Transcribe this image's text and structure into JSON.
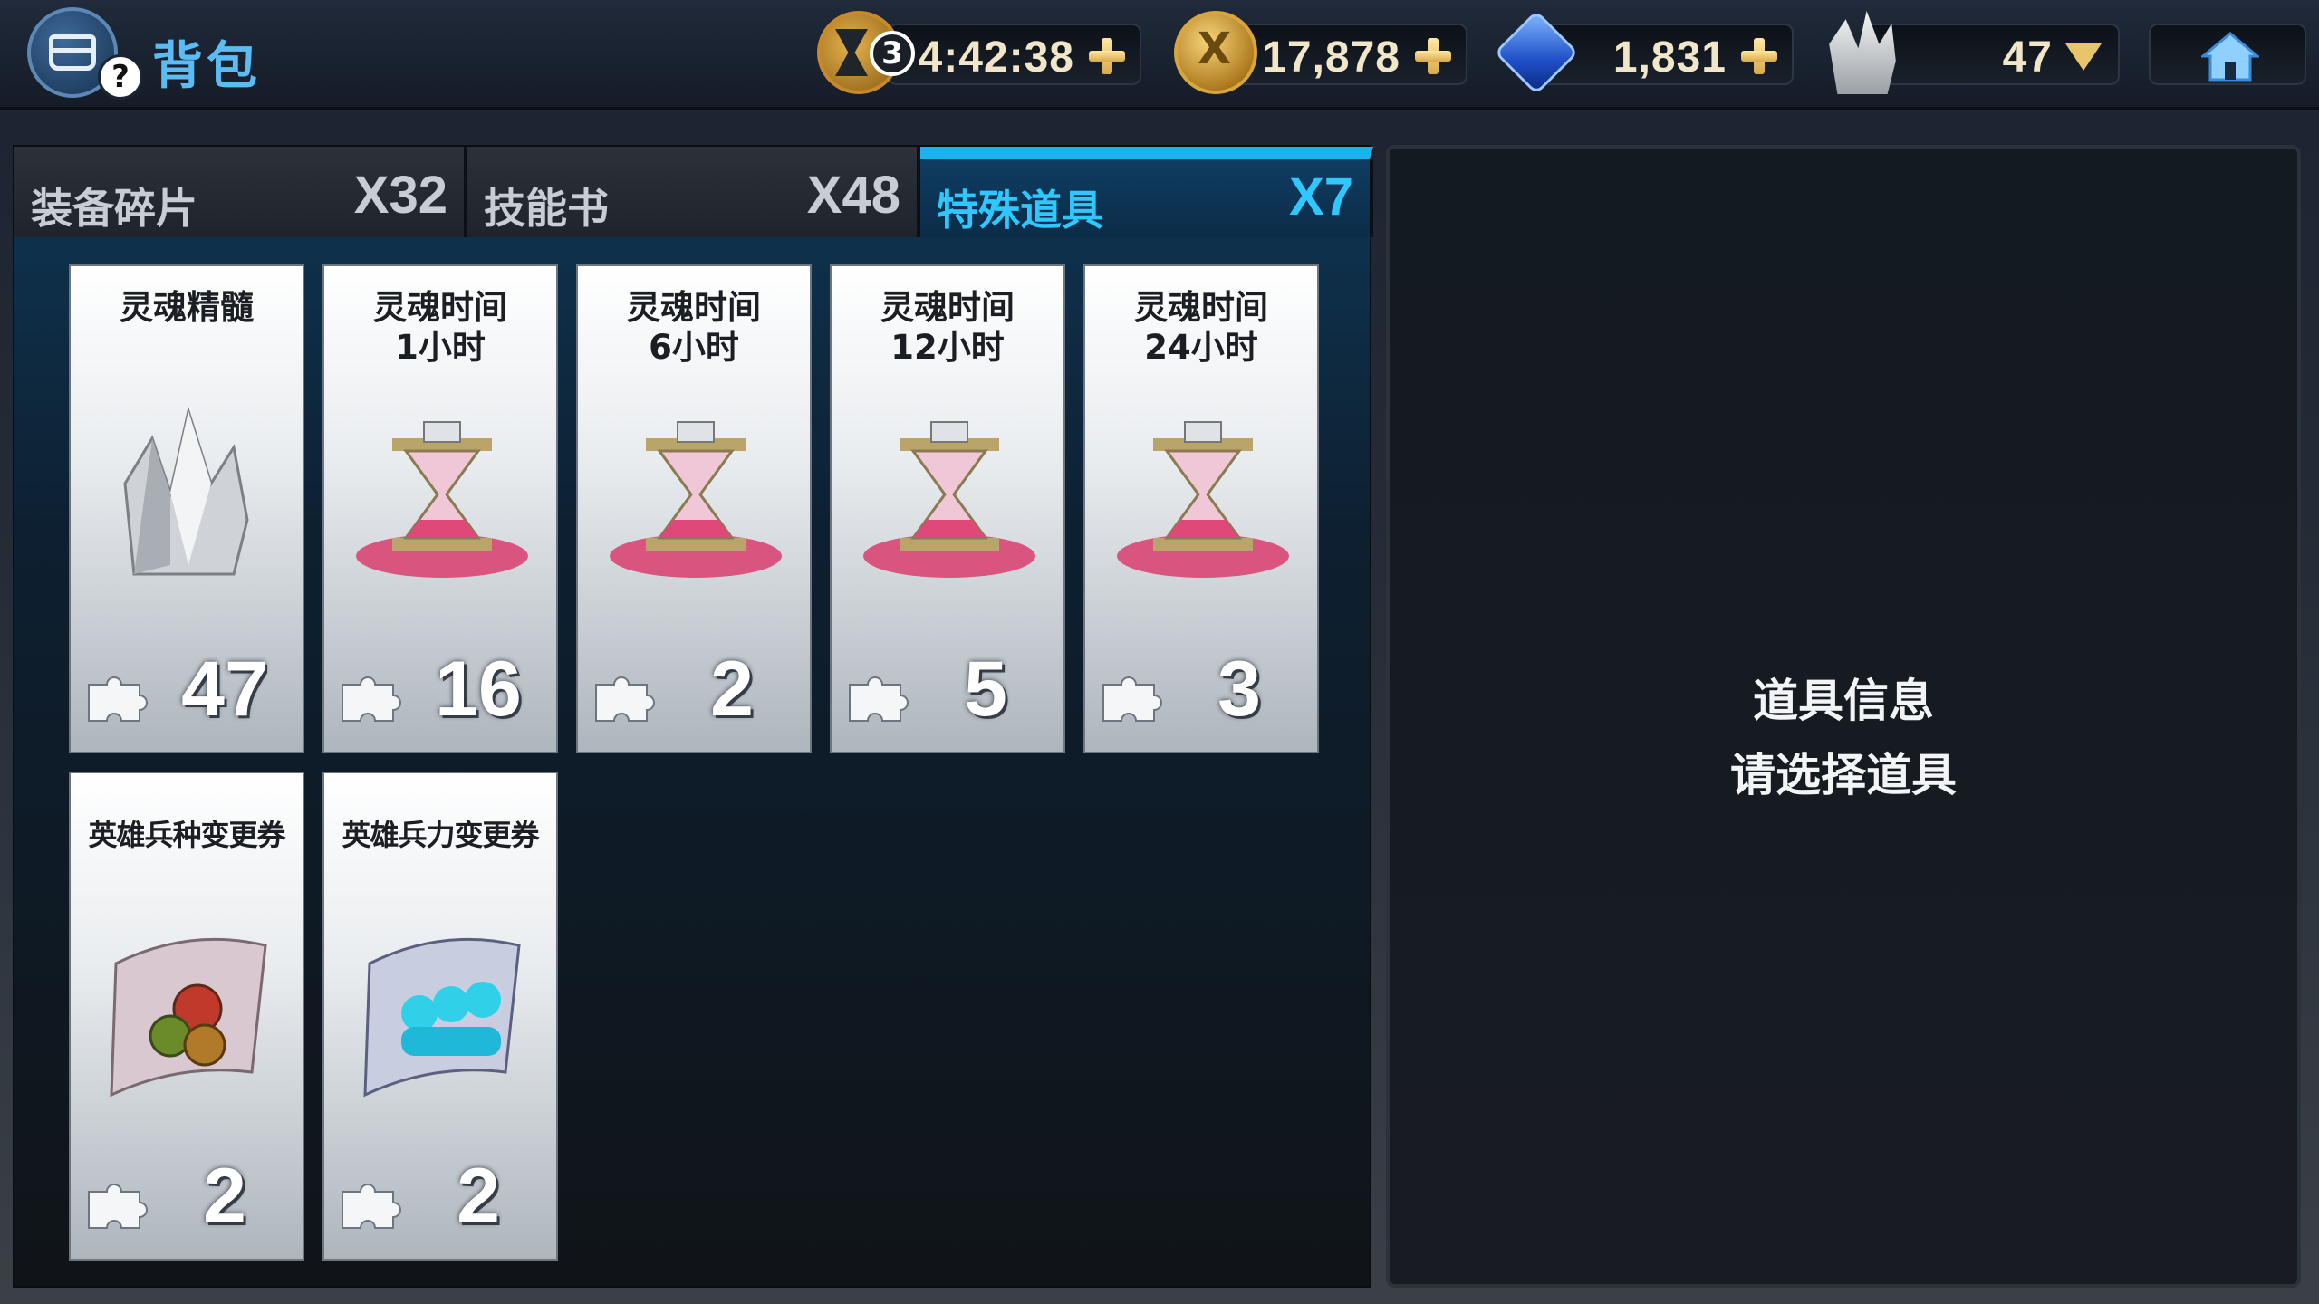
{
  "header": {
    "title": "背包",
    "help": "?",
    "timer": {
      "badge": "3",
      "value": "4:42:38"
    },
    "gold": {
      "value": "17,878"
    },
    "gems": {
      "value": "1,831"
    },
    "soul_essence": {
      "value": "47"
    }
  },
  "tabs": [
    {
      "label": "装备碎片",
      "count": "X32",
      "active": false
    },
    {
      "label": "技能书",
      "count": "X48",
      "active": false
    },
    {
      "label": "特殊道具",
      "count": "X7",
      "active": true
    }
  ],
  "items": [
    {
      "name": "灵魂精髓",
      "count": "47",
      "icon": "soul-crystal-icon"
    },
    {
      "name": "灵魂时间\n1小时",
      "count": "16",
      "icon": "hourglass-icon"
    },
    {
      "name": "灵魂时间\n6小时",
      "count": "2",
      "icon": "hourglass-icon"
    },
    {
      "name": "灵魂时间\n12小时",
      "count": "5",
      "icon": "hourglass-icon"
    },
    {
      "name": "灵魂时间\n24小时",
      "count": "3",
      "icon": "hourglass-icon"
    },
    {
      "name": "英雄兵种变更券",
      "count": "2",
      "icon": "troop-type-scroll-icon"
    },
    {
      "name": "英雄兵力变更券",
      "count": "2",
      "icon": "troop-power-scroll-icon"
    }
  ],
  "info_panel": {
    "title": "道具信息",
    "hint": "请选择道具"
  },
  "colors": {
    "accent": "#2ec8ff",
    "title": "#5bbcf5",
    "gold": "#e8c46a"
  }
}
